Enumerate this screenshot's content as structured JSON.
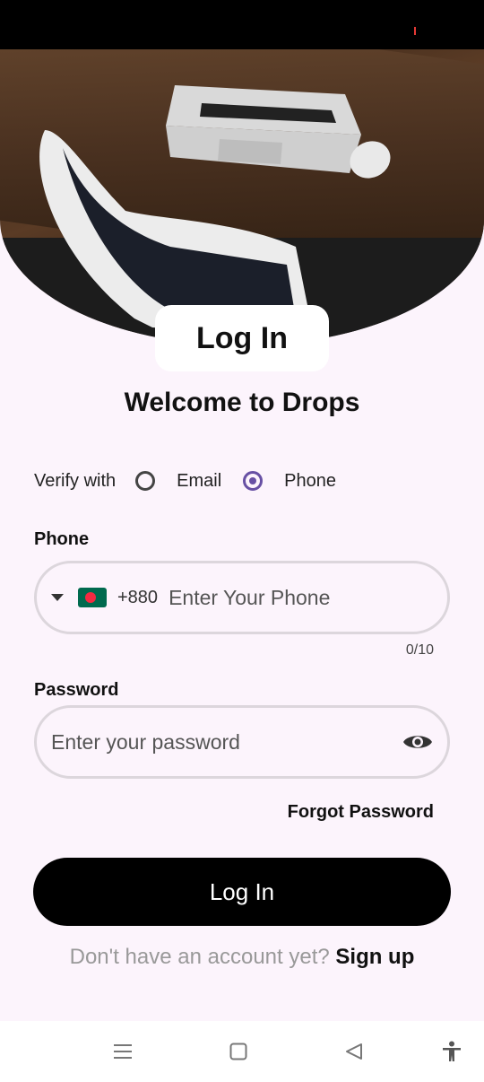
{
  "screen": {
    "title": "Log In",
    "welcome": "Welcome to Drops"
  },
  "verify": {
    "label": "Verify with",
    "options": [
      {
        "label": "Email",
        "selected": false
      },
      {
        "label": "Phone",
        "selected": true
      }
    ]
  },
  "phone": {
    "label": "Phone",
    "country_code": "+880",
    "country_flag": "bangladesh-flag-icon",
    "placeholder": "Enter Your Phone",
    "value": "",
    "counter": "0/10"
  },
  "password": {
    "label": "Password",
    "placeholder": "Enter your password",
    "value": ""
  },
  "links": {
    "forgot_password": "Forgot Password",
    "no_account": "Don't have an account yet?",
    "sign_up": "Sign up"
  },
  "buttons": {
    "login": "Log In"
  },
  "colors": {
    "accent": "#6750a4",
    "button_bg": "#000000",
    "page_bg": "#fcf4fc"
  },
  "icons": {
    "dropdown": "caret-down-icon",
    "visibility": "eye-icon",
    "nav_menu": "menu-icon",
    "nav_home": "square-icon",
    "nav_back": "back-triangle-icon",
    "nav_accessibility": "accessibility-icon"
  }
}
